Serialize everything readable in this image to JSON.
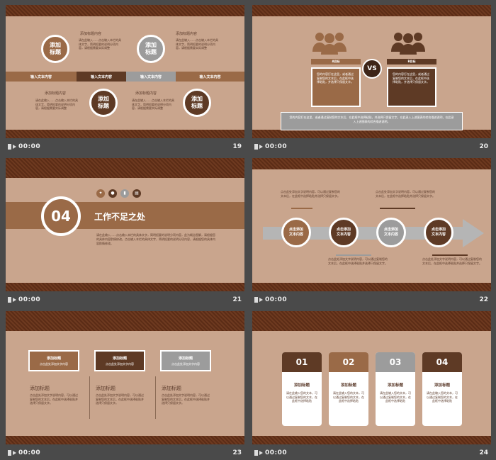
{
  "slides": [
    {
      "time": "00:00",
      "num": "19",
      "heading_a": "添加标题内容",
      "heading_b": "添加标题内容",
      "heading_c": "添加标题内容",
      "heading_d": "添加标题内容",
      "body_a": "请在此输入……点击输入本栏的具体文字，简明扼要的说明分项内容，请根据需要实际调整",
      "body_b": "请在此输入……点击输入本栏的具体文字，简明扼要的说明分项内容，请根据需要实际调整",
      "body_c": "请在此输入……点击输入本栏的具体文字，简明扼要的说明分项内容，请根据需要实际调整",
      "body_d": "请在此输入……点击输入本栏的具体文字，简明扼要的说明分项内容，请根据需要实际调整",
      "circles": [
        "添加\n标题",
        "添加\n标题",
        "添加\n标题",
        "添加\n标题"
      ],
      "bars": [
        "输入文本内容",
        "输入文本内容",
        "输入文本内容",
        "输入文本内容"
      ]
    },
    {
      "time": "00:00",
      "num": "20",
      "left_title": "A目标",
      "right_title": "B目标",
      "vs": "VS",
      "left_body": "您的内容打在这里，或者通过复制您的文本后，在此框中选择粘贴，并选择只保留文字。",
      "right_body": "您的内容打在这里，或者通过复制您的文本后，在此框中选择粘贴，并选择只保留文字。",
      "bottom_body": "您的内容打在这里，或者通过复制您的文本后，在此框中选择粘贴，并选择只保留文字。在此录入上述图表的综合描述说明，在此录入上述图表的综合描述说明。"
    },
    {
      "time": "00:00",
      "num": "21",
      "number": "04",
      "title": "工作不足之处",
      "body": "请在此输入……点击输入本栏的具体文字，简明扼要的说明分项内容，此为概念图解，请根据您的具体内容酌情修改。点击输入本栏的具体文字，简明扼要的说明分项内容，请根据您的具体内容酌情修改。"
    },
    {
      "time": "00:00",
      "num": "22",
      "circles": [
        "点击添加\n文本内容",
        "点击添加\n文本内容",
        "点击添加\n文本内容",
        "点击添加\n文本内容"
      ],
      "note_top_a": "点击此处添加文字说明内容，可以通过复制您的文本后，在此框中选择粘贴并选择只保留文字。",
      "note_top_b": "点击此处添加文字说明内容，可以通过复制您的文本后，在此框中选择粘贴并选择只保留文字。",
      "note_bot_a": "点击此处添加文字说明内容，可以通过复制您的文本后，在此框中选择粘贴并选择只保留文字。",
      "note_bot_b": "点击此处添加文字说明内容，可以通过复制您的文本后，在此框中选择粘贴并选择只保留文字。"
    },
    {
      "time": "00:00",
      "num": "23",
      "boxes": [
        {
          "title": "添加标题",
          "sub": "点击此处添加文字内容"
        },
        {
          "title": "添加标题",
          "sub": "点击此处添加文字内容"
        },
        {
          "title": "添加标题",
          "sub": "点击此处添加文字内容"
        }
      ],
      "cols": [
        {
          "title": "添加标题",
          "body": "点击此处添加文字说明内容，可以通过复制您的文本后，在此框中选择粘贴并选择只保留文字。"
        },
        {
          "title": "添加标题",
          "body": "点击此处添加文字说明内容，可以通过复制您的文本后，在此框中选择粘贴并选择只保留文字。"
        },
        {
          "title": "添加标题",
          "body": "点击此处添加文字说明内容，可以通过复制您的文本后，在此框中选择粘贴并选择只保留文字。"
        }
      ]
    },
    {
      "time": "00:00",
      "num": "24",
      "cards": [
        {
          "n": "01",
          "title": "添加标题",
          "body": "请在此输入您的文本，可以通过复制您的文本，在此框中选择粘贴"
        },
        {
          "n": "02",
          "title": "添加标题",
          "body": "请在此输入您的文本，可以通过复制您的文本，在此框中选择粘贴"
        },
        {
          "n": "03",
          "title": "添加标题",
          "body": "请在此输入您的文本，可以通过复制您的文本，在此框中选择粘贴"
        },
        {
          "n": "04",
          "title": "添加标题",
          "body": "请在此输入您的文本，可以通过复制您的文本，在此框中选择粘贴"
        }
      ]
    }
  ],
  "colors": {
    "bg": "#4a4a4a",
    "slide": "#c9a58d",
    "dark": "#5e3a25",
    "medium": "#9a6a47",
    "gray": "#9c9c9c"
  }
}
